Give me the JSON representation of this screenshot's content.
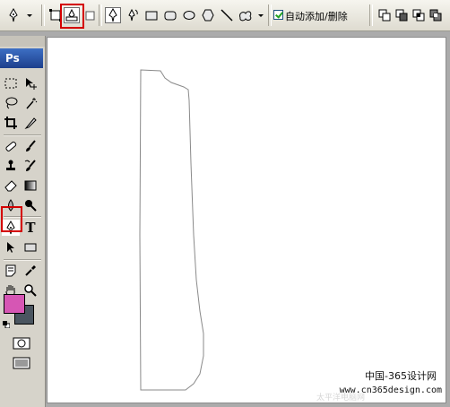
{
  "options_bar": {
    "auto_add_delete_label": "自动添加/删除",
    "auto_add_delete_checked": true,
    "selected_mode": "paths-icon"
  },
  "toolbox": {
    "logo_text": "Ps",
    "type_tool_label": "T",
    "active_tool": "pen-tool",
    "foreground_color": "#d656b4",
    "background_color": "#4a5560"
  },
  "watermark": {
    "line1": "中国-365设计网",
    "line2": "www.cn365design.com",
    "faded": "太平洋电脑网"
  },
  "highlight_color": "#d40000"
}
